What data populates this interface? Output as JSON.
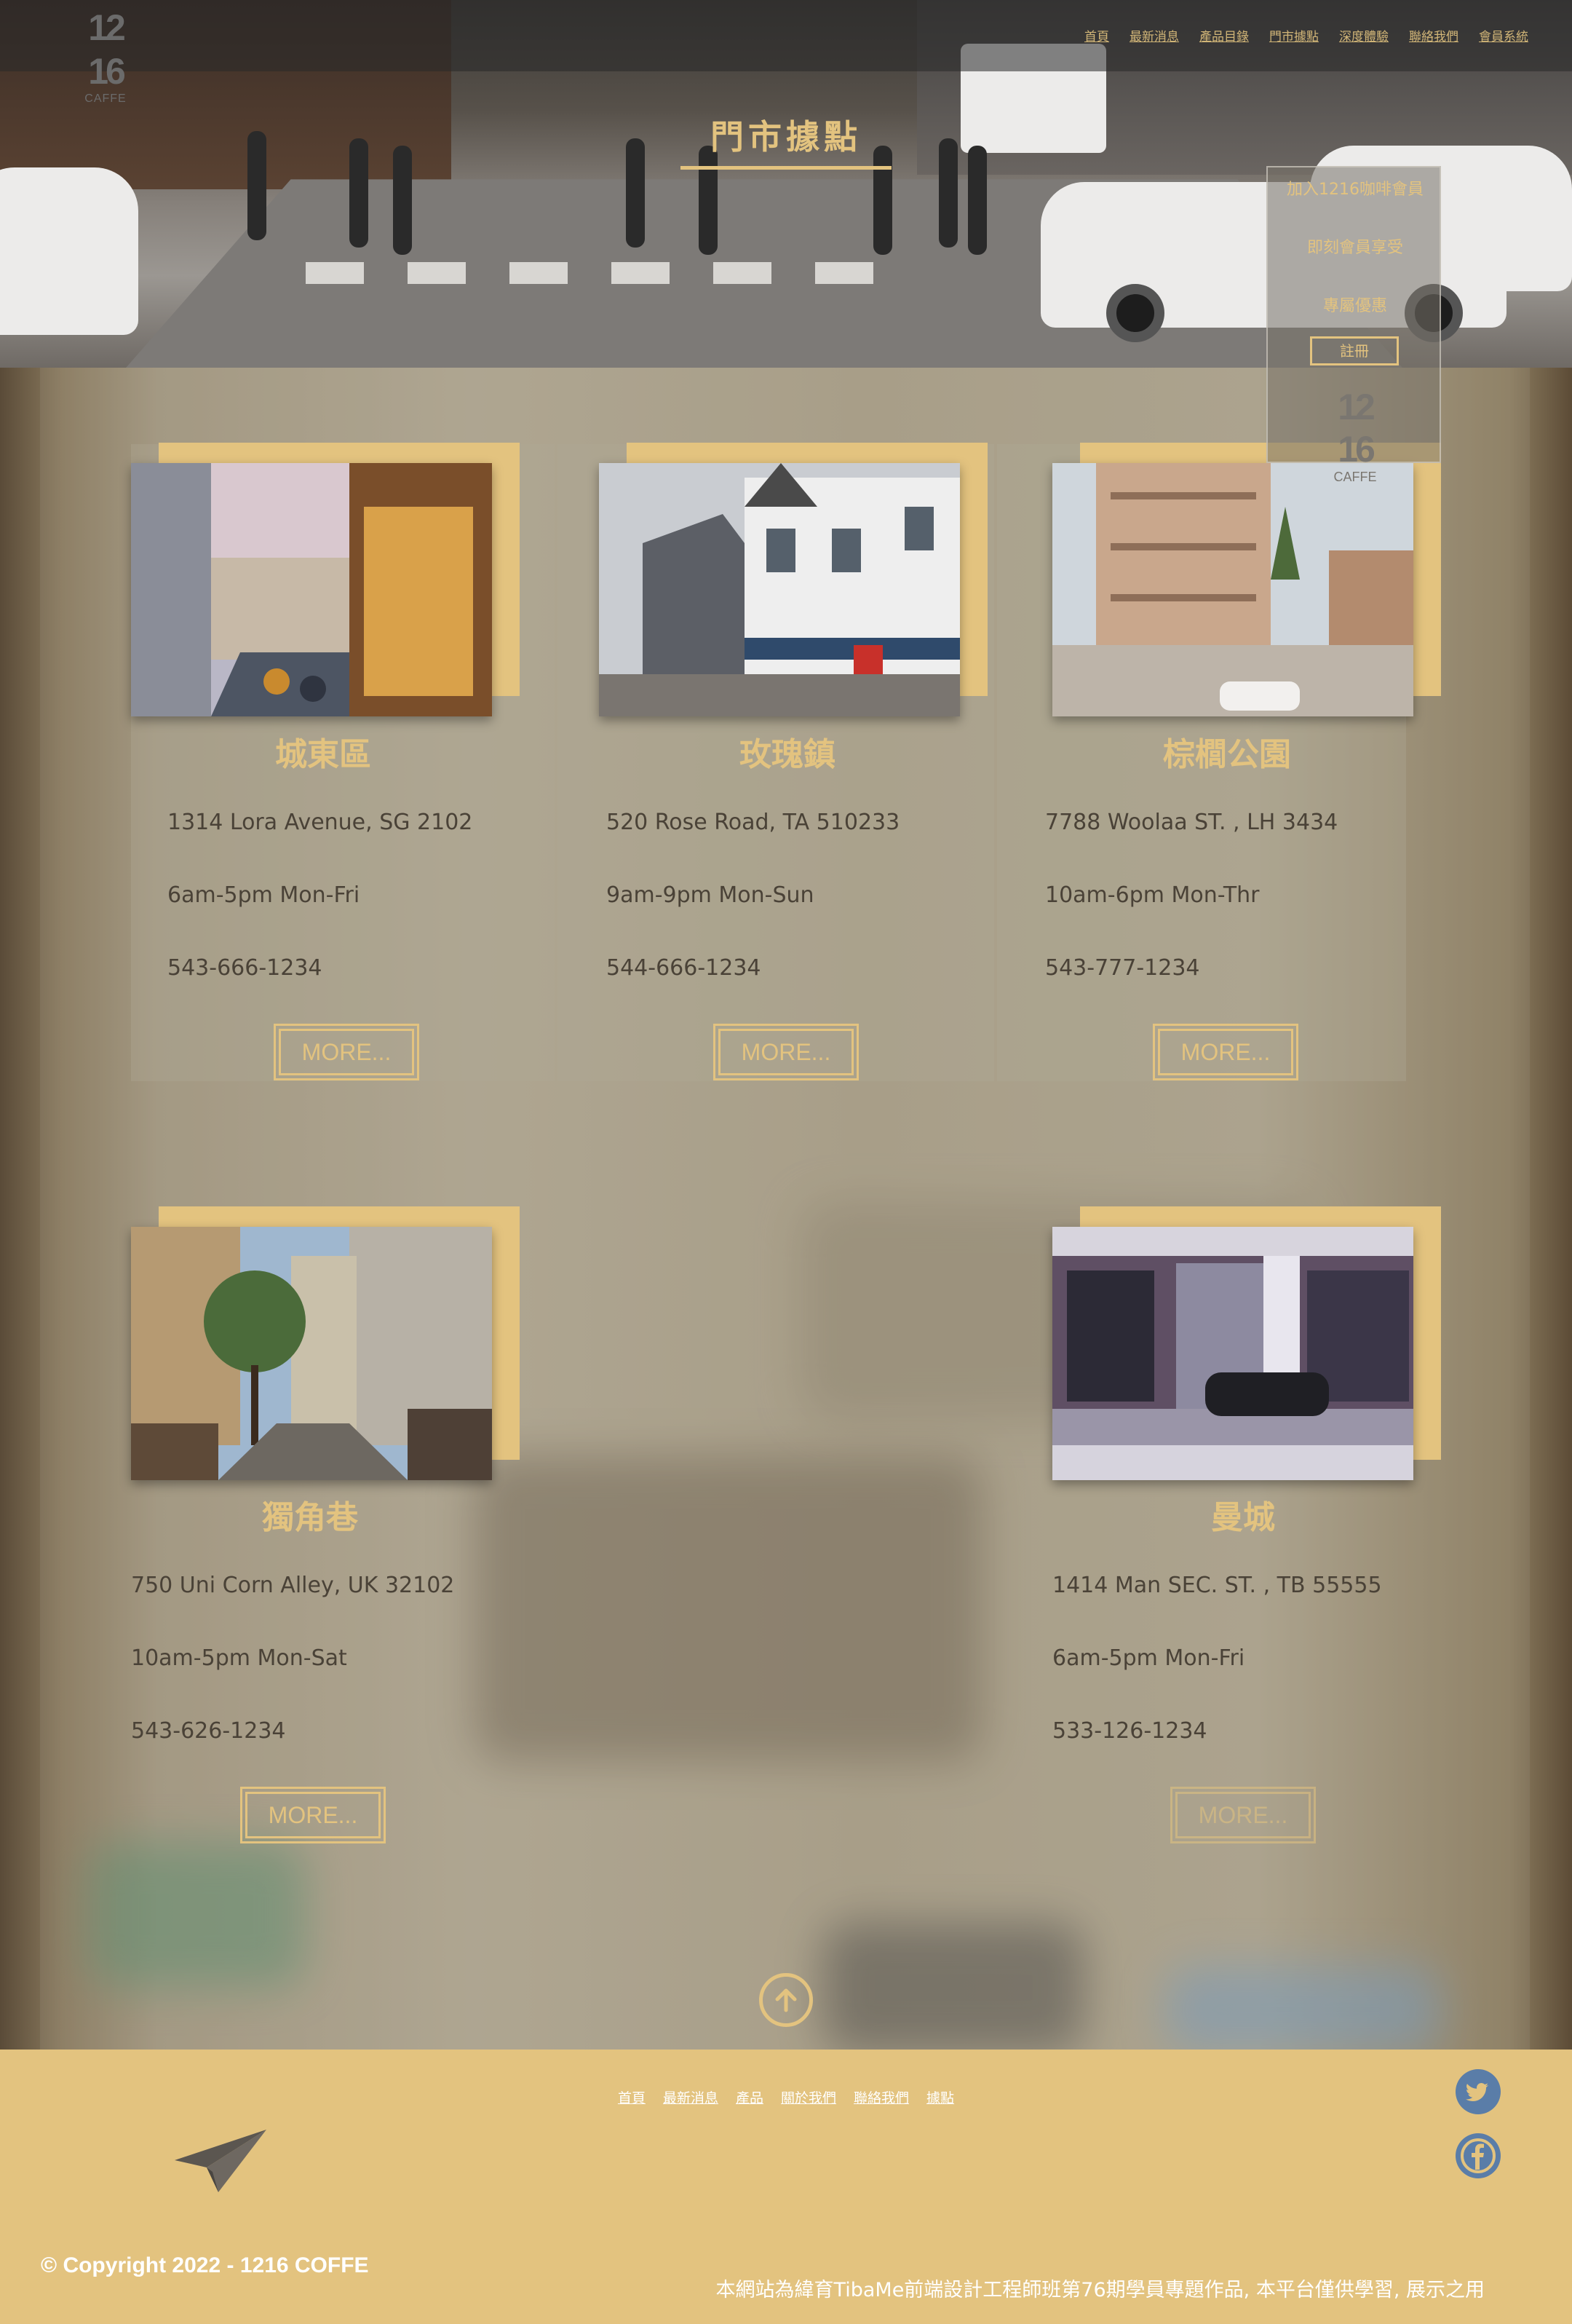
{
  "header": {
    "logo_number": "12\n16",
    "logo_text": "CAFFE",
    "nav": [
      "首頁",
      "最新消息",
      "產品目錄",
      "門市據點",
      "深度體驗",
      "聯絡我們",
      "會員系統"
    ]
  },
  "page_title": "門市據點",
  "member_panel": {
    "items": [
      "加入1216咖啡會員",
      "即刻會員享受",
      "專屬優惠"
    ],
    "register_label": "註冊",
    "logo_number": "12\n16",
    "logo_text": "CAFFE"
  },
  "stores": [
    {
      "name": "城東區",
      "address": "1314 Lora Avenue, SG 2102",
      "hours": "6am-5pm Mon-Fri",
      "phone": "543-666-1234",
      "more": "MORE..."
    },
    {
      "name": "玫瑰鎮",
      "address": "520 Rose Road, TA 510233",
      "hours": "9am-9pm Mon-Sun",
      "phone": "544-666-1234",
      "more": "MORE..."
    },
    {
      "name": "棕櫚公園",
      "address": "7788 Woolaa ST. , LH 3434",
      "hours": "10am-6pm Mon-Thr",
      "phone": "543-777-1234",
      "more": "MORE..."
    },
    {
      "name": "獨角巷",
      "address": "750 Uni Corn Alley, UK 32102",
      "hours": "10am-5pm Mon-Sat",
      "phone": "543-626-1234",
      "more": "MORE..."
    },
    {
      "name": "曼城",
      "address": "1414 Man SEC. ST. , TB 55555",
      "hours": "6am-5pm Mon-Fri",
      "phone": "533-126-1234",
      "more": "MORE..."
    }
  ],
  "footer": {
    "nav": [
      "首頁",
      "最新消息",
      "產品",
      "關於我們",
      "聯絡我們",
      "據點"
    ],
    "copyright": "© Copyright 2022 - 1216 COFFE",
    "disclaimer": "本網站為緯育TibaMe前端設計工程師班第76期學員專題作品, 本平台僅供學習, 展示之用"
  },
  "colors": {
    "accent": "#e3c37f",
    "social": "#5a7da8"
  }
}
